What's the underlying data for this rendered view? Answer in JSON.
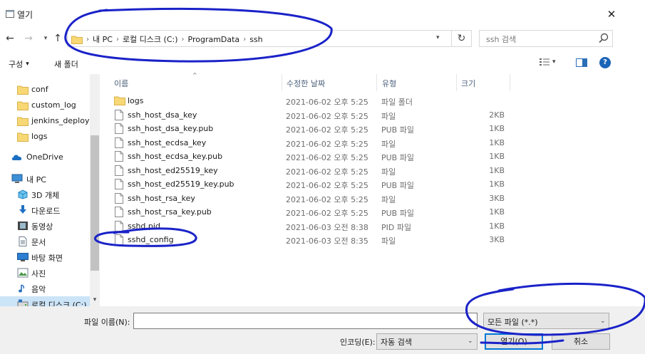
{
  "window": {
    "title": "열기",
    "close_glyph": "✕"
  },
  "address": {
    "crumbs": [
      "내 PC",
      "로컬 디스크 (C:)",
      "ProgramData",
      "ssh"
    ],
    "search_placeholder": "ssh 검색"
  },
  "toolbar": {
    "organize_label": "구성",
    "new_folder_label": "새 폴더",
    "help_glyph": "?"
  },
  "nav": {
    "items": [
      {
        "label": "conf",
        "icon": "folder-icon",
        "indent": 1
      },
      {
        "label": "custom_log",
        "icon": "folder-icon",
        "indent": 1
      },
      {
        "label": "jenkins_deploy",
        "icon": "folder-icon",
        "indent": 1
      },
      {
        "label": "logs",
        "icon": "folder-icon",
        "indent": 1
      },
      {
        "label": "OneDrive",
        "icon": "onedrive-icon",
        "indent": 0
      },
      {
        "label": "내 PC",
        "icon": "pc-icon",
        "indent": 0
      },
      {
        "label": "3D 개체",
        "icon": "3d-objects-icon",
        "indent": 1
      },
      {
        "label": "다운로드",
        "icon": "downloads-icon",
        "indent": 1
      },
      {
        "label": "동영상",
        "icon": "videos-icon",
        "indent": 1
      },
      {
        "label": "문서",
        "icon": "documents-icon",
        "indent": 1
      },
      {
        "label": "바탕 화면",
        "icon": "desktop-icon",
        "indent": 1
      },
      {
        "label": "사진",
        "icon": "pictures-icon",
        "indent": 1
      },
      {
        "label": "음악",
        "icon": "music-icon",
        "indent": 1
      },
      {
        "label": "로컬 디스크 (C:)",
        "icon": "drive-icon",
        "indent": 1,
        "selected": true
      }
    ]
  },
  "columns": {
    "name": "이름",
    "date": "수정한 날짜",
    "type": "유형",
    "size": "크기"
  },
  "files": [
    {
      "name": "logs",
      "date": "2021-06-02 오후 5:25",
      "type": "파일 폴더",
      "size": "",
      "icon": "folder-icon"
    },
    {
      "name": "ssh_host_dsa_key",
      "date": "2021-06-02 오후 5:25",
      "type": "파일",
      "size": "2KB",
      "icon": "file-icon"
    },
    {
      "name": "ssh_host_dsa_key.pub",
      "date": "2021-06-02 오후 5:25",
      "type": "PUB 파일",
      "size": "1KB",
      "icon": "file-icon"
    },
    {
      "name": "ssh_host_ecdsa_key",
      "date": "2021-06-02 오후 5:25",
      "type": "파일",
      "size": "1KB",
      "icon": "file-icon"
    },
    {
      "name": "ssh_host_ecdsa_key.pub",
      "date": "2021-06-02 오후 5:25",
      "type": "PUB 파일",
      "size": "1KB",
      "icon": "file-icon"
    },
    {
      "name": "ssh_host_ed25519_key",
      "date": "2021-06-02 오후 5:25",
      "type": "파일",
      "size": "1KB",
      "icon": "file-icon"
    },
    {
      "name": "ssh_host_ed25519_key.pub",
      "date": "2021-06-02 오후 5:25",
      "type": "PUB 파일",
      "size": "1KB",
      "icon": "file-icon"
    },
    {
      "name": "ssh_host_rsa_key",
      "date": "2021-06-02 오후 5:25",
      "type": "파일",
      "size": "3KB",
      "icon": "file-icon"
    },
    {
      "name": "ssh_host_rsa_key.pub",
      "date": "2021-06-02 오후 5:25",
      "type": "PUB 파일",
      "size": "1KB",
      "icon": "file-icon"
    },
    {
      "name": "sshd.pid",
      "date": "2021-06-03 오전 8:38",
      "type": "PID 파일",
      "size": "1KB",
      "icon": "file-icon"
    },
    {
      "name": "sshd_config",
      "date": "2021-06-03 오전 8:35",
      "type": "파일",
      "size": "3KB",
      "icon": "file-icon"
    }
  ],
  "bottom": {
    "filename_label": "파일 이름(N):",
    "filename_value": "",
    "filetype_value": "모든 파일 (*.*)",
    "encoding_label": "인코딩(E):",
    "encoding_value": "자동 검색",
    "open_label": "열기(O)",
    "cancel_label": "취소"
  },
  "colors": {
    "folder": "#f8d775",
    "selection": "#cce4f7",
    "annotation_ink": "#1a22c8",
    "accent": "#0078d7"
  }
}
